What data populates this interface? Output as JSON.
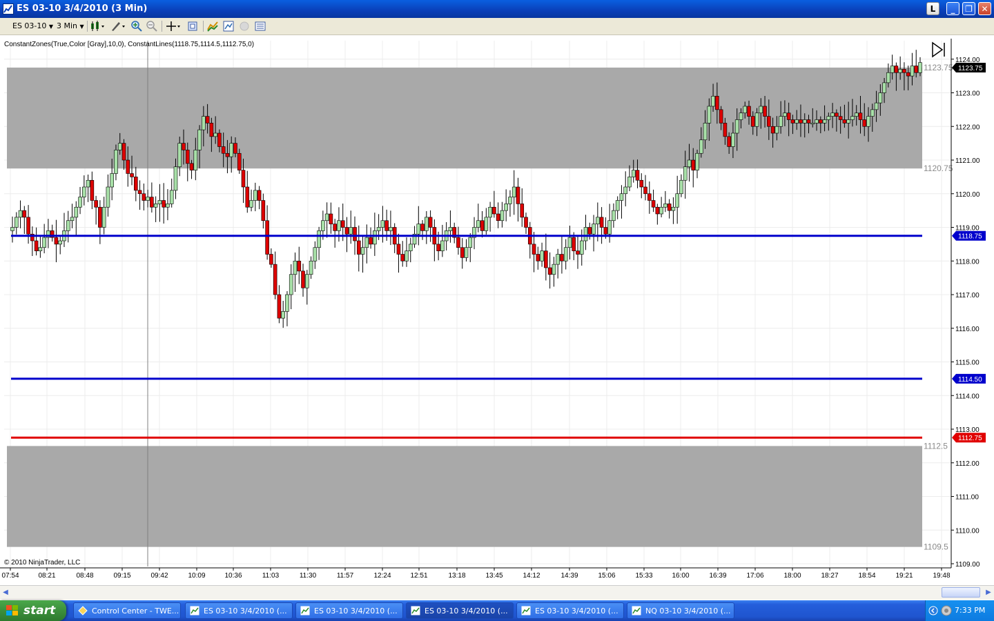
{
  "window": {
    "title": "ES 03-10  3/4/2010 (3 Min)",
    "btn_l": "L",
    "btn_min": "_",
    "btn_restore": "❐",
    "btn_close": "✕"
  },
  "toolbar": {
    "instrument": "ES 03-10",
    "interval": "3 Min"
  },
  "chart": {
    "indicator_label": "ConstantZones(True,Color [Gray],10,0), ConstantLines(1118.75,1114.5,1112.75,0)",
    "copyright": "© 2010 NinjaTrader, LLC",
    "y_ticks": [
      "1124.00",
      "1123.00",
      "1122.00",
      "1121.00",
      "1120.00",
      "1119.00",
      "1118.00",
      "1117.00",
      "1116.00",
      "1115.00",
      "1114.00",
      "1113.00",
      "1112.00",
      "1111.00",
      "1110.00",
      "1109.00"
    ],
    "x_ticks": [
      "07:54",
      "08:21",
      "08:48",
      "09:15",
      "09:42",
      "10:09",
      "10:36",
      "11:03",
      "11:30",
      "11:57",
      "12:24",
      "12:51",
      "13:18",
      "13:45",
      "14:12",
      "14:39",
      "15:06",
      "15:33",
      "16:00",
      "16:39",
      "17:06",
      "18:00",
      "18:27",
      "18:54",
      "19:21",
      "19:48"
    ],
    "zone_labels": {
      "upper_top": "1123.75",
      "upper_bottom": "1120.75",
      "lower_top": "1112.5",
      "lower_bottom": "1109.5"
    },
    "lines": [
      {
        "label": "1118.75",
        "color": "#0000cc"
      },
      {
        "label": "1114.50",
        "color": "#0000cc"
      },
      {
        "label": "1112.75",
        "color": "#e00000"
      }
    ],
    "last_price": "1123.75",
    "colors": {
      "up": "#a8e0a8",
      "down": "#dd0000",
      "zone": "#a9a9a9",
      "blue_line": "#0000cc",
      "red_line": "#e00000"
    }
  },
  "chart_data": {
    "type": "candlestick",
    "title": "",
    "ylim": [
      1109.0,
      1124.2
    ],
    "zones": [
      [
        1120.75,
        1123.75
      ],
      [
        1109.5,
        1112.5
      ]
    ],
    "hlines": [
      1118.75,
      1114.5,
      1112.75
    ],
    "closes": [
      1119.0,
      1119.3,
      1119.5,
      1119.3,
      1118.8,
      1118.6,
      1118.3,
      1118.4,
      1118.7,
      1118.9,
      1118.7,
      1118.5,
      1118.6,
      1118.9,
      1119.2,
      1119.3,
      1119.6,
      1119.9,
      1120.2,
      1120.4,
      1119.8,
      1119.6,
      1119.0,
      1119.6,
      1120.2,
      1120.6,
      1121.3,
      1121.5,
      1121.0,
      1120.6,
      1120.5,
      1120.1,
      1120.0,
      1119.8,
      1119.9,
      1119.6,
      1119.7,
      1119.8,
      1119.6,
      1119.7,
      1120.1,
      1120.8,
      1121.5,
      1121.3,
      1120.9,
      1120.7,
      1121.3,
      1121.9,
      1122.3,
      1122.1,
      1121.7,
      1121.8,
      1121.4,
      1121.2,
      1121.1,
      1121.5,
      1121.2,
      1120.7,
      1120.2,
      1119.6,
      1119.8,
      1120.1,
      1119.8,
      1119.2,
      1118.2,
      1117.9,
      1117.0,
      1116.3,
      1116.5,
      1117.0,
      1117.6,
      1118.0,
      1117.7,
      1117.2,
      1117.6,
      1118.0,
      1118.4,
      1118.9,
      1119.2,
      1119.4,
      1119.1,
      1118.9,
      1119.2,
      1119.0,
      1118.8,
      1119.0,
      1118.6,
      1118.2,
      1118.4,
      1118.7,
      1118.5,
      1118.9,
      1119.0,
      1119.2,
      1118.9,
      1119.0,
      1118.5,
      1118.2,
      1118.0,
      1118.3,
      1118.5,
      1118.8,
      1119.1,
      1118.9,
      1119.3,
      1119.0,
      1118.5,
      1118.3,
      1118.6,
      1118.9,
      1119.0,
      1118.7,
      1118.4,
      1118.1,
      1118.4,
      1118.7,
      1119.0,
      1119.2,
      1118.9,
      1119.3,
      1119.6,
      1119.4,
      1119.2,
      1119.5,
      1119.7,
      1119.9,
      1120.2,
      1119.7,
      1119.3,
      1119.0,
      1118.5,
      1118.2,
      1118.0,
      1118.3,
      1117.8,
      1117.6,
      1117.9,
      1118.2,
      1118.0,
      1118.4,
      1118.7,
      1118.3,
      1118.2,
      1118.6,
      1119.0,
      1118.8,
      1119.1,
      1119.3,
      1119.0,
      1118.8,
      1119.2,
      1119.5,
      1119.8,
      1120.0,
      1120.2,
      1120.5,
      1120.7,
      1120.4,
      1120.2,
      1120.0,
      1119.8,
      1119.6,
      1119.4,
      1119.6,
      1119.7,
      1119.5,
      1119.6,
      1120.0,
      1120.4,
      1120.8,
      1121.0,
      1120.7,
      1121.2,
      1121.6,
      1122.1,
      1122.6,
      1122.9,
      1122.5,
      1122.1,
      1121.7,
      1121.4,
      1121.8,
      1122.2,
      1122.4,
      1122.6,
      1122.3,
      1122.0,
      1122.4,
      1122.6,
      1122.3,
      1122.0,
      1121.8,
      1122.0,
      1122.3,
      1122.4,
      1122.2,
      1122.1,
      1122.2,
      1122.1,
      1122.2,
      1122.1,
      1122.1,
      1122.2,
      1122.1,
      1122.2,
      1122.3,
      1122.4,
      1122.3,
      1122.2,
      1122.1,
      1122.2,
      1122.3,
      1122.4,
      1122.2,
      1122.0,
      1122.3,
      1122.5,
      1122.7,
      1123.0,
      1123.3,
      1123.6,
      1123.8,
      1123.6,
      1123.7,
      1123.6,
      1123.5,
      1123.8,
      1123.6,
      1123.9
    ]
  }
}
